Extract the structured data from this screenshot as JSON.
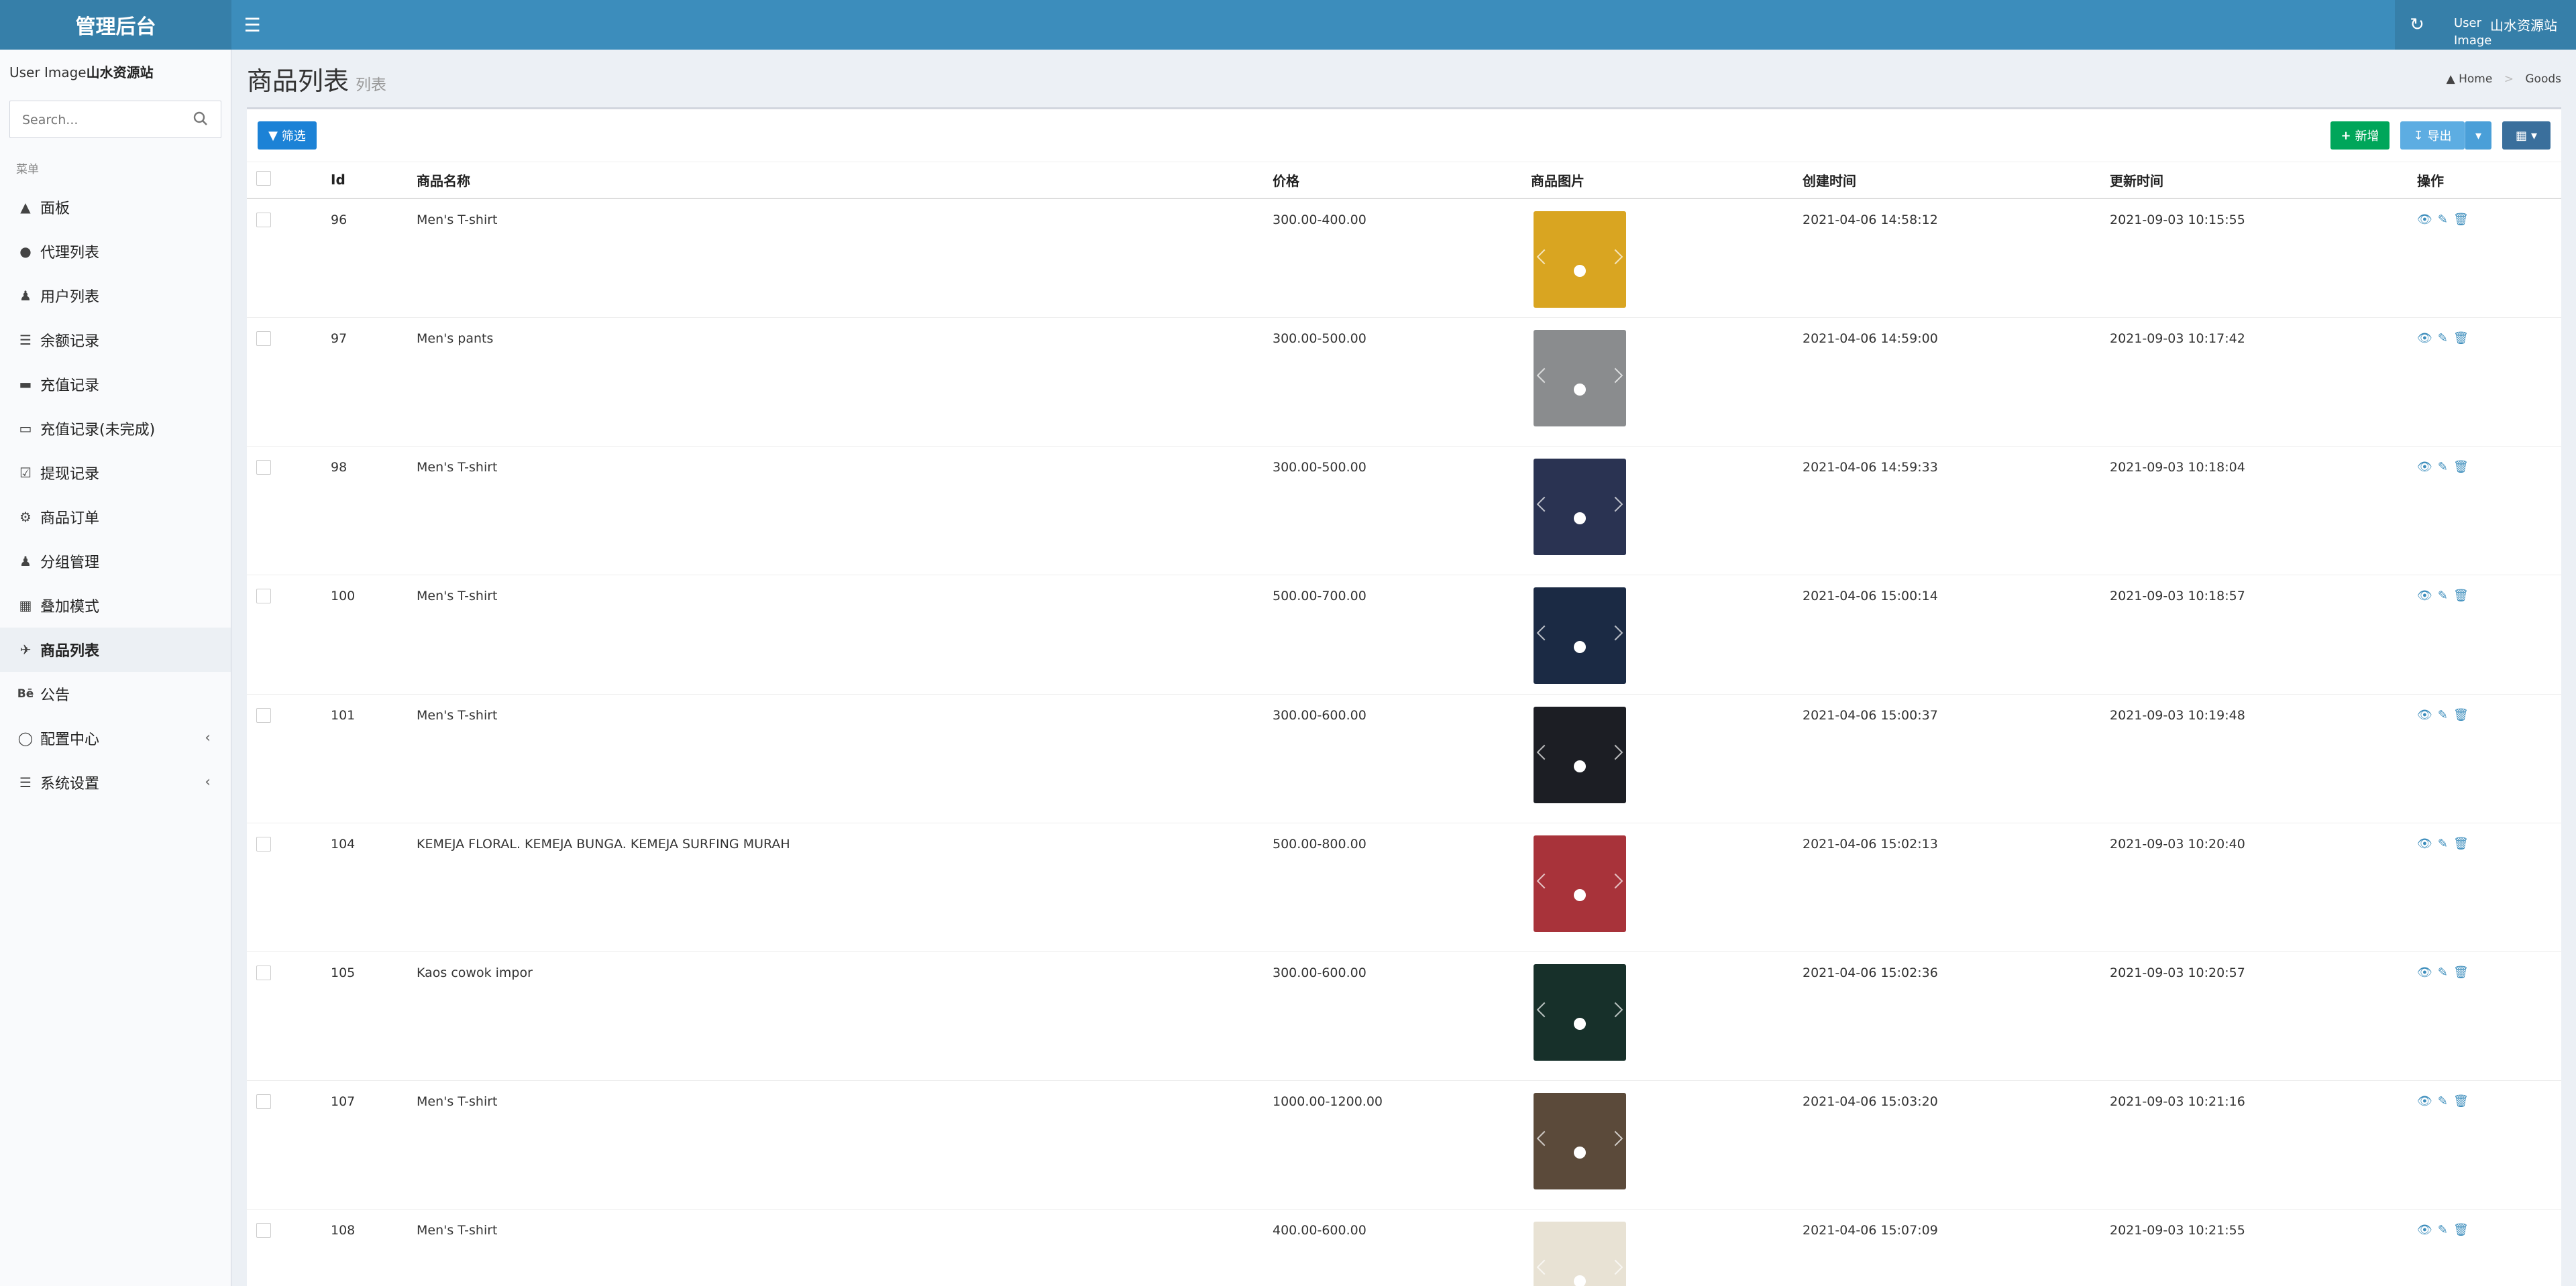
{
  "header": {
    "logo": "管理后台",
    "user_image_alt": "User Image",
    "user_name": "山水资源站"
  },
  "sidebar": {
    "user_image_alt": "User Image",
    "user_name": "山水资源站",
    "search_placeholder": "Search...",
    "menu_header": "菜单",
    "items": [
      {
        "label": "面板",
        "icon": "dashboard-icon"
      },
      {
        "label": "代理列表",
        "icon": "circle-icon"
      },
      {
        "label": "用户列表",
        "icon": "user-icon"
      },
      {
        "label": "余额记录",
        "icon": "list-icon"
      },
      {
        "label": "充值记录",
        "icon": "battery-icon"
      },
      {
        "label": "充值记录(未完成)",
        "icon": "battery-empty-icon"
      },
      {
        "label": "提现记录",
        "icon": "check-square-icon"
      },
      {
        "label": "商品订单",
        "icon": "gear-icon"
      },
      {
        "label": "分组管理",
        "icon": "users-icon"
      },
      {
        "label": "叠加模式",
        "icon": "object-group-icon"
      },
      {
        "label": "商品列表",
        "icon": "fighter-jet-icon"
      },
      {
        "label": "公告",
        "icon": "behance-icon"
      },
      {
        "label": "配置中心",
        "icon": "life-ring-icon"
      },
      {
        "label": "系统设置",
        "icon": "settings-list-icon"
      }
    ]
  },
  "content": {
    "title": "商品列表",
    "subtitle": "列表",
    "breadcrumb": [
      "Home",
      "Goods"
    ]
  },
  "toolbar": {
    "filter_label": "筛选",
    "add_label": "新增",
    "export_label": "导出"
  },
  "table": {
    "columns": [
      "Id",
      "商品名称",
      "价格",
      "商品图片",
      "创建时间",
      "更新时间",
      "操作"
    ],
    "rows": [
      {
        "id": "96",
        "name": "Men's T-shirt",
        "price": "300.00-400.00",
        "created": "2021-04-06 14:58:12",
        "updated": "2021-09-03 10:15:55",
        "img_color": "#d9a521"
      },
      {
        "id": "97",
        "name": "Men's pants",
        "price": "300.00-500.00",
        "created": "2021-04-06 14:59:00",
        "updated": "2021-09-03 10:17:42",
        "img_color": "#8a8c8e"
      },
      {
        "id": "98",
        "name": "Men's T-shirt",
        "price": "300.00-500.00",
        "created": "2021-04-06 14:59:33",
        "updated": "2021-09-03 10:18:04",
        "img_color": "#2a3352"
      },
      {
        "id": "100",
        "name": "Men's T-shirt",
        "price": "500.00-700.00",
        "created": "2021-04-06 15:00:14",
        "updated": "2021-09-03 10:18:57",
        "img_color": "#1b2a44"
      },
      {
        "id": "101",
        "name": "Men's T-shirt",
        "price": "300.00-600.00",
        "created": "2021-04-06 15:00:37",
        "updated": "2021-09-03 10:19:48",
        "img_color": "#1c1e24"
      },
      {
        "id": "104",
        "name": "KEMEJA FLORAL. KEMEJA BUNGA. KEMEJA SURFING MURAH",
        "price": "500.00-800.00",
        "created": "2021-04-06 15:02:13",
        "updated": "2021-09-03 10:20:40",
        "img_color": "#a8333a"
      },
      {
        "id": "105",
        "name": "Kaos cowok impor",
        "price": "300.00-600.00",
        "created": "2021-04-06 15:02:36",
        "updated": "2021-09-03 10:20:57",
        "img_color": "#17302a"
      },
      {
        "id": "107",
        "name": "Men's T-shirt",
        "price": "1000.00-1200.00",
        "created": "2021-04-06 15:03:20",
        "updated": "2021-09-03 10:21:16",
        "img_color": "#5b4a3a"
      },
      {
        "id": "108",
        "name": "Men's T-shirt",
        "price": "400.00-600.00",
        "created": "2021-04-06 15:07:09",
        "updated": "2021-09-03 10:21:55",
        "img_color": "#e8e2d4"
      }
    ]
  }
}
